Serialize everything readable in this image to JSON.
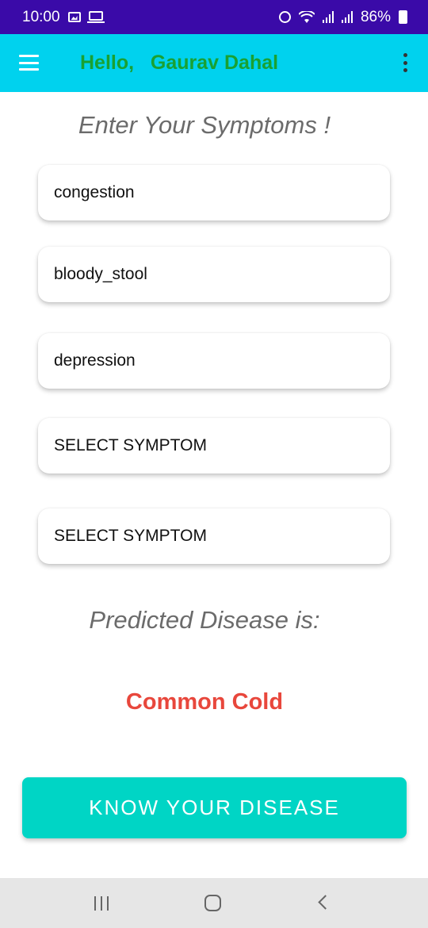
{
  "status_bar": {
    "time": "10:00",
    "battery": "86%",
    "icons": [
      "image-icon",
      "laptop-icon",
      "alarm-icon",
      "wifi-icon",
      "signal-icon",
      "signal-icon",
      "battery-charging-icon"
    ]
  },
  "app_bar": {
    "greeting": "Hello,   Gaurav Dahal",
    "menu_icon": "hamburger-icon",
    "overflow_icon": "kebab-menu-icon",
    "colors": {
      "background": "#00d2ee",
      "greeting": "#19a132"
    }
  },
  "main": {
    "heading": "Enter Your Symptoms !",
    "symptoms": [
      {
        "value": "congestion"
      },
      {
        "value": "bloody_stool"
      },
      {
        "value": "depression"
      },
      {
        "value": "SELECT SYMPTOM"
      },
      {
        "value": "SELECT SYMPTOM"
      }
    ],
    "predicted_label": "Predicted Disease is:",
    "predicted_disease": "Common Cold",
    "button_label": "KNOW YOUR DISEASE",
    "colors": {
      "disease": "#e8473c",
      "button": "#00d5c5"
    }
  },
  "nav_bar": {
    "icons": [
      "recents-icon",
      "home-icon",
      "back-icon"
    ]
  }
}
